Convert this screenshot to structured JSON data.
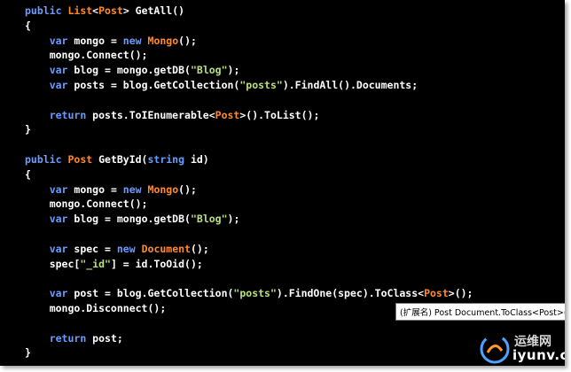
{
  "colors": {
    "background": "#000000",
    "keyword": "#6a9cff",
    "type": "#ff8a2b",
    "string": "#b7e07a",
    "text": "#ffffff"
  },
  "code_lines": [
    [
      {
        "k": "kw",
        "t": "public "
      },
      {
        "k": "type",
        "t": "List"
      },
      {
        "k": "text",
        "t": "<"
      },
      {
        "k": "type",
        "t": "Post"
      },
      {
        "k": "text",
        "t": "> GetAll()"
      }
    ],
    [
      {
        "k": "text",
        "t": "{"
      }
    ],
    [
      {
        "k": "text",
        "t": "    "
      },
      {
        "k": "kw",
        "t": "var"
      },
      {
        "k": "text",
        "t": " mongo = "
      },
      {
        "k": "kw",
        "t": "new"
      },
      {
        "k": "text",
        "t": " "
      },
      {
        "k": "type",
        "t": "Mongo"
      },
      {
        "k": "text",
        "t": "();"
      }
    ],
    [
      {
        "k": "text",
        "t": "    mongo.Connect();"
      }
    ],
    [
      {
        "k": "text",
        "t": "    "
      },
      {
        "k": "kw",
        "t": "var"
      },
      {
        "k": "text",
        "t": " blog = mongo.getDB("
      },
      {
        "k": "str",
        "t": "\"Blog\""
      },
      {
        "k": "text",
        "t": ");"
      }
    ],
    [
      {
        "k": "text",
        "t": "    "
      },
      {
        "k": "kw",
        "t": "var"
      },
      {
        "k": "text",
        "t": " posts = blog.GetCollection("
      },
      {
        "k": "str",
        "t": "\"posts\""
      },
      {
        "k": "text",
        "t": ").FindAll().Documents;"
      }
    ],
    [],
    [
      {
        "k": "text",
        "t": "    "
      },
      {
        "k": "kw",
        "t": "return"
      },
      {
        "k": "text",
        "t": " posts.ToIEnumerable<"
      },
      {
        "k": "type",
        "t": "Post"
      },
      {
        "k": "text",
        "t": ">().ToList();"
      }
    ],
    [
      {
        "k": "text",
        "t": "}"
      }
    ],
    [],
    [
      {
        "k": "kw",
        "t": "public "
      },
      {
        "k": "type",
        "t": "Post"
      },
      {
        "k": "text",
        "t": " GetById("
      },
      {
        "k": "kw",
        "t": "string"
      },
      {
        "k": "text",
        "t": " id)"
      }
    ],
    [
      {
        "k": "text",
        "t": "{"
      }
    ],
    [
      {
        "k": "text",
        "t": "    "
      },
      {
        "k": "kw",
        "t": "var"
      },
      {
        "k": "text",
        "t": " mongo = "
      },
      {
        "k": "kw",
        "t": "new"
      },
      {
        "k": "text",
        "t": " "
      },
      {
        "k": "type",
        "t": "Mongo"
      },
      {
        "k": "text",
        "t": "();"
      }
    ],
    [
      {
        "k": "text",
        "t": "    mongo.Connect();"
      }
    ],
    [
      {
        "k": "text",
        "t": "    "
      },
      {
        "k": "kw",
        "t": "var"
      },
      {
        "k": "text",
        "t": " blog = mongo.getDB("
      },
      {
        "k": "str",
        "t": "\"Blog\""
      },
      {
        "k": "text",
        "t": ");"
      }
    ],
    [],
    [
      {
        "k": "text",
        "t": "    "
      },
      {
        "k": "kw",
        "t": "var"
      },
      {
        "k": "text",
        "t": " spec = "
      },
      {
        "k": "kw",
        "t": "new"
      },
      {
        "k": "text",
        "t": " "
      },
      {
        "k": "type",
        "t": "Document"
      },
      {
        "k": "text",
        "t": "();"
      }
    ],
    [
      {
        "k": "text",
        "t": "    spec["
      },
      {
        "k": "str",
        "t": "\"_id\""
      },
      {
        "k": "text",
        "t": "] = id.ToOid();"
      }
    ],
    [],
    [
      {
        "k": "text",
        "t": "    "
      },
      {
        "k": "kw",
        "t": "var"
      },
      {
        "k": "text",
        "t": " post = blog.GetCollection("
      },
      {
        "k": "str",
        "t": "\"posts\""
      },
      {
        "k": "text",
        "t": ").FindOne(spec).ToClass<"
      },
      {
        "k": "type",
        "t": "Post"
      },
      {
        "k": "text",
        "t": ">();"
      }
    ],
    [
      {
        "k": "text",
        "t": "    mongo.Disconnect();"
      }
    ],
    [],
    [
      {
        "k": "text",
        "t": "    "
      },
      {
        "k": "kw",
        "t": "return"
      },
      {
        "k": "text",
        "t": " post;"
      }
    ],
    [
      {
        "k": "text",
        "t": "}"
      }
    ]
  ],
  "tooltip": {
    "text": "(扩展名) Post Document.ToClass<Post>()"
  },
  "watermark": {
    "cn": "运维网",
    "en": "iyunv.com"
  }
}
